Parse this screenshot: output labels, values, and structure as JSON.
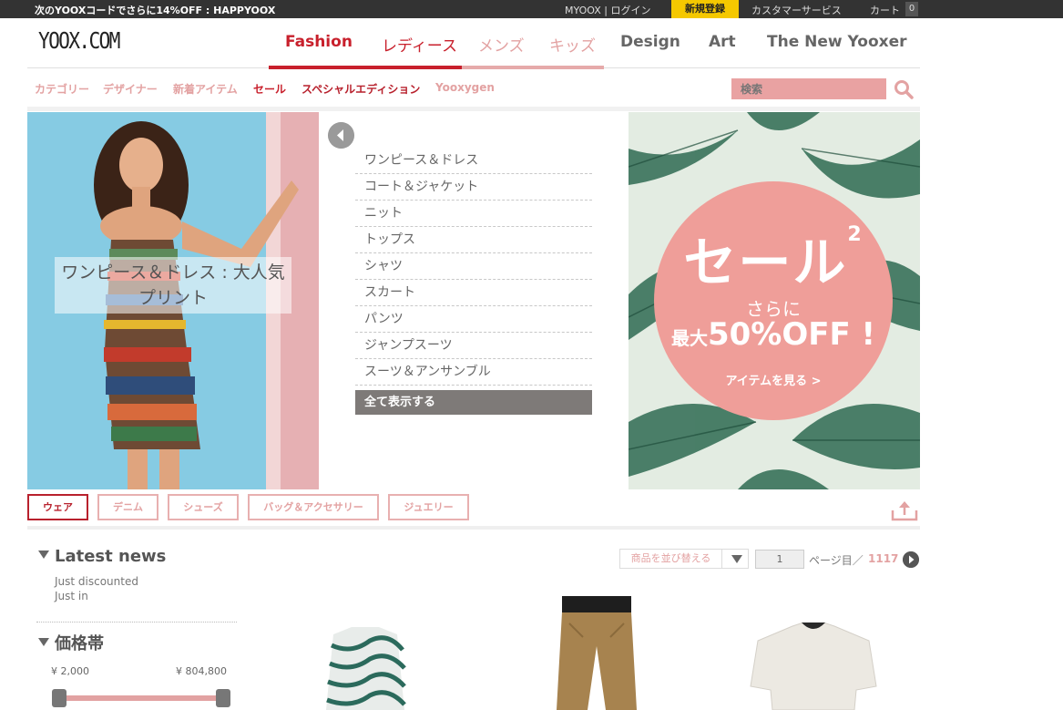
{
  "topbar": {
    "promo": "次のYOOXコードでさらに14%OFF : HAPPYOOX",
    "myoox_login": "MYOOX | ログイン",
    "register": "新規登録",
    "customer_service": "カスタマーサービス",
    "cart": "カート",
    "cart_count": "0"
  },
  "header": {
    "logo": "YOOX.COM",
    "nav": [
      "Fashion",
      "レディース",
      "メンズ",
      "キッズ",
      "Design",
      "Art",
      "The New Yooxer"
    ]
  },
  "subnav": {
    "items": [
      "カテゴリー",
      "デザイナー",
      "新着アイテム",
      "セール",
      "スペシャルエディション",
      "Yooxygen"
    ],
    "search_placeholder": "検索"
  },
  "hero": {
    "caption_line1": "ワンピース＆ドレス : 大人気",
    "caption_line2": "プリント"
  },
  "categories": {
    "items": [
      "ワンピース＆ドレス",
      "コート＆ジャケット",
      "ニット",
      "トップス",
      "シャツ",
      "スカート",
      "パンツ",
      "ジャンプスーツ",
      "スーツ＆アンサンブル"
    ],
    "show_all": "全て表示する"
  },
  "sale": {
    "title": "セール",
    "sup": "2",
    "sub": "さらに",
    "main_prefix": "最大",
    "main": "50%OFF !",
    "link": "アイテムを見る >"
  },
  "tabs": [
    "ウェア",
    "デニム",
    "シューズ",
    "バッグ＆アクセサリー",
    "ジュエリー"
  ],
  "filters": {
    "latest_news_title": "Latest news",
    "news_links": [
      "Just discounted",
      "Just in"
    ],
    "price_title": "価格帯",
    "price_min": "¥ 2,000",
    "price_max": "¥ 804,800"
  },
  "paging": {
    "sort_label": "商品を並び替える",
    "current_page": "1",
    "page_suffix": "ページ目／",
    "total_pages": "1117"
  },
  "colors": {
    "accent_red": "#c8202c",
    "accent_pink": "#e3a2a2",
    "register_yellow": "#f5c800"
  }
}
